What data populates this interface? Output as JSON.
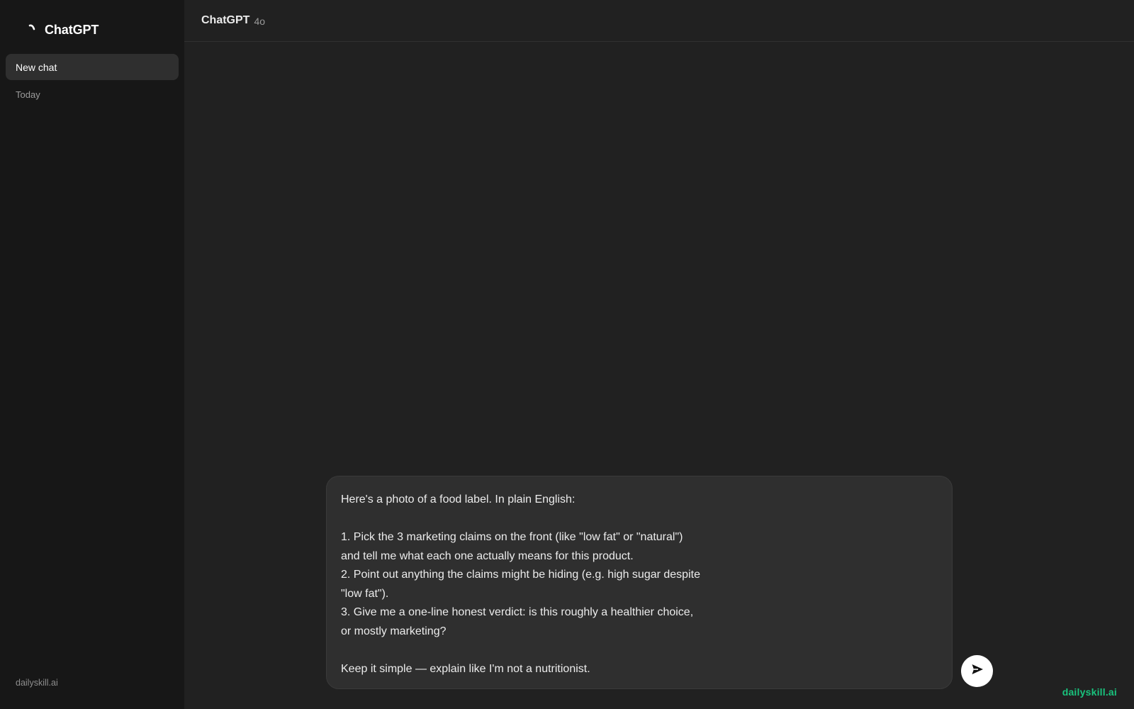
{
  "sidebar": {
    "brand_title": "ChatGPT",
    "brand_icon": "chatgpt-spinner-logo",
    "new_chat_label": "New chat",
    "section_label": "Today",
    "footer_text": "dailyskill.ai"
  },
  "header": {
    "model_name": "ChatGPT",
    "model_version": "4o"
  },
  "composer": {
    "text": "Here's a photo of a food label. In plain English:\n\n1. Pick the 3 marketing claims on the front (like \"low fat\" or \"natural\")\nand tell me what each one actually means for this product.\n2. Point out anything the claims might be hiding (e.g. high sugar despite\n\"low fat\").\n3. Give me a one-line honest verdict: is this roughly a healthier choice,\nor mostly marketing?\n\nKeep it simple — explain like I'm not a nutritionist."
  },
  "send_button": {
    "icon": "send-arrow-icon"
  },
  "watermark": {
    "text": "dailyskill.ai",
    "color": "#19c37d"
  },
  "colors": {
    "sidebar_bg": "#171717",
    "main_bg": "#212121",
    "composer_bg": "#2f2f2f",
    "accent": "#19c37d"
  }
}
